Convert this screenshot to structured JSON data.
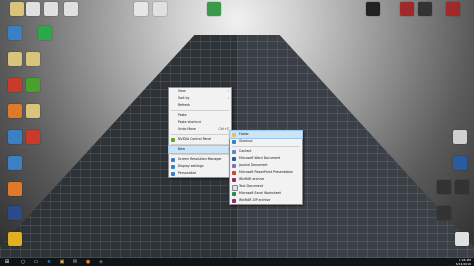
{
  "desktop_icons": [
    {
      "label": "",
      "color": "#d8c47a"
    },
    {
      "label": "",
      "color": "#e0e0e0"
    },
    {
      "label": "",
      "color": "#e0e0e0"
    },
    {
      "label": "",
      "color": "#e0e0e0"
    },
    {
      "label": "",
      "color": "#e6e6e6"
    },
    {
      "label": "",
      "color": "#e0e0e0"
    },
    {
      "label": "",
      "color": "#3a9a4a"
    },
    {
      "label": "",
      "color": "#3b7fc4"
    },
    {
      "label": "",
      "color": "#2aa84a"
    },
    {
      "label": "",
      "color": "#d8c47a"
    },
    {
      "label": "",
      "color": "#d8c47a"
    },
    {
      "label": "",
      "color": "#c83a2a"
    },
    {
      "label": "",
      "color": "#4aa02a"
    },
    {
      "label": "",
      "color": "#e07a2a"
    },
    {
      "label": "",
      "color": "#d8c47a"
    },
    {
      "label": "",
      "color": "#3b7fc4"
    },
    {
      "label": "",
      "color": "#c83a2a"
    },
    {
      "label": "",
      "color": "#3b7fc4"
    },
    {
      "label": "",
      "color": "#e07a2a"
    },
    {
      "label": "",
      "color": "#2a4a8a"
    },
    {
      "label": "",
      "color": "#e0b020"
    },
    {
      "label": "",
      "color": "#222222"
    },
    {
      "label": "",
      "color": "#a02a2a"
    },
    {
      "label": "",
      "color": "#333333"
    },
    {
      "label": "",
      "color": "#a02a2a"
    },
    {
      "label": "",
      "color": "#d0d0d0"
    },
    {
      "label": "",
      "color": "#2a5aa0"
    },
    {
      "label": "",
      "color": "#333333"
    },
    {
      "label": "",
      "color": "#333333"
    },
    {
      "label": "",
      "color": "#333333"
    },
    {
      "label": "",
      "color": "#e0e0e0"
    }
  ],
  "context_menu": {
    "items": [
      {
        "label": "View",
        "has_sub": true
      },
      {
        "label": "Sort by",
        "has_sub": true
      },
      {
        "label": "Refresh",
        "has_sub": false
      },
      {
        "label": "Paste",
        "has_sub": false
      },
      {
        "label": "Paste shortcut",
        "has_sub": false
      },
      {
        "label": "Undo Move",
        "has_sub": false,
        "shortcut": "Ctrl+Z"
      },
      {
        "label": "NVIDIA Control Panel",
        "has_sub": false
      },
      {
        "label": "New",
        "has_sub": true,
        "highlighted": true
      },
      {
        "label": "Screen Resolution Manager",
        "has_sub": false
      },
      {
        "label": "Display settings",
        "has_sub": false
      },
      {
        "label": "Personalize",
        "has_sub": false
      }
    ]
  },
  "submenu": {
    "items": [
      {
        "label": "Folder",
        "color": "#e8c060",
        "highlighted": true
      },
      {
        "label": "Shortcut",
        "color": "#3b7fc4"
      },
      {
        "label": "Contact",
        "color": "#5a8ac8"
      },
      {
        "label": "Microsoft Word Document",
        "color": "#2a5aa0"
      },
      {
        "label": "Journal Document",
        "color": "#8a6ac0"
      },
      {
        "label": "Microsoft PowerPoint Presentation",
        "color": "#c84a2a"
      },
      {
        "label": "WinRAR archive",
        "color": "#8a2a6a"
      },
      {
        "label": "Text Document",
        "color": "#e0e0e0"
      },
      {
        "label": "Microsoft Excel Worksheet",
        "color": "#2a8a4a"
      },
      {
        "label": "WinRAR ZIP archive",
        "color": "#8a2a6a"
      }
    ]
  },
  "taskbar": {
    "start_icon": "⊞",
    "items": [
      "○",
      "▭",
      "e",
      "▣",
      "✉",
      "●",
      "◈"
    ],
    "time": "1:06 PM",
    "date": "5/24/2016"
  }
}
